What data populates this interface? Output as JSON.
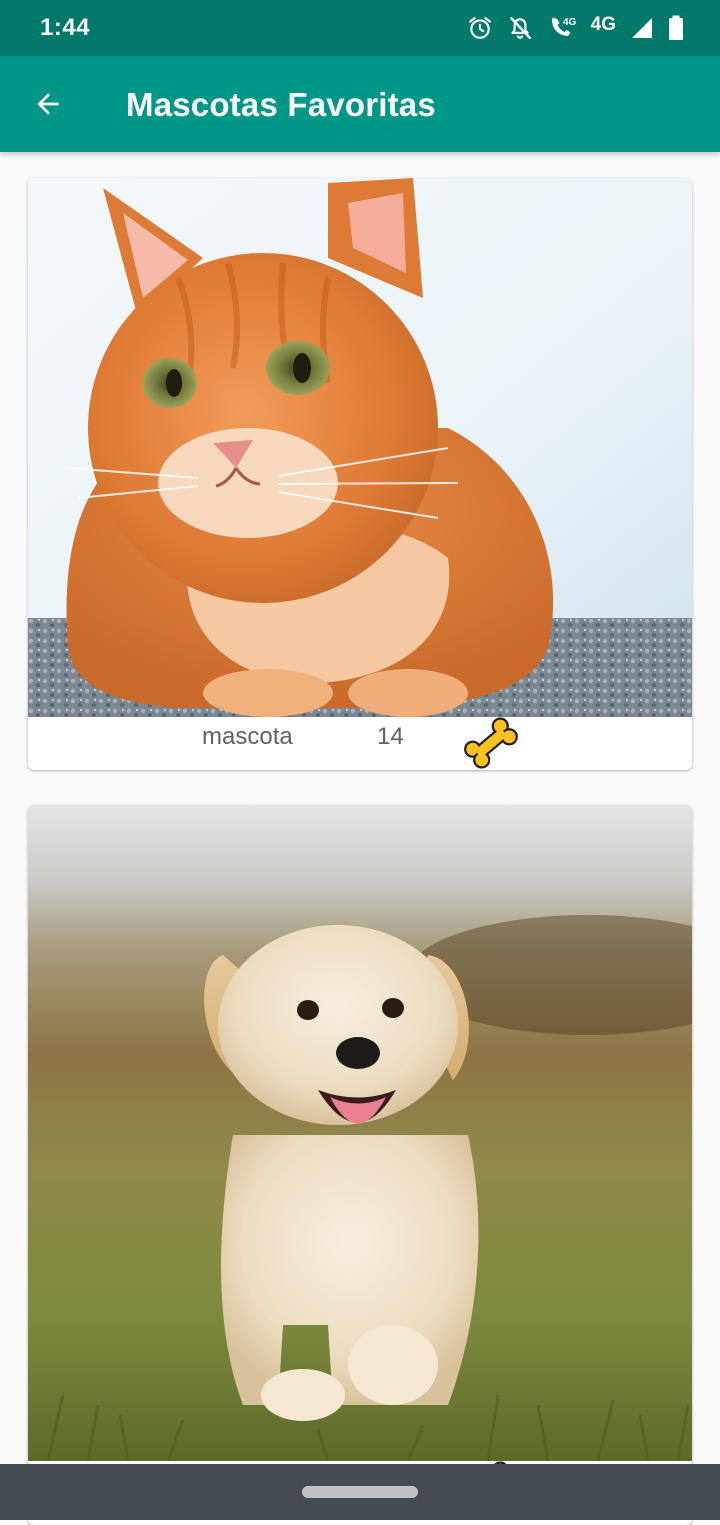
{
  "status_bar": {
    "time": "1:44",
    "network_type": "4G",
    "icons": [
      "alarm-icon",
      "notifications-off-icon",
      "volte-call-icon",
      "signal-icon",
      "battery-icon"
    ]
  },
  "app_bar": {
    "title": "Mascotas Favoritas",
    "back_icon": "arrow-back-icon",
    "color": "#009688",
    "status_color": "#00796b"
  },
  "pets": [
    {
      "name": "mascota",
      "rating": "14",
      "photo": "orange-cat-photo",
      "like_icon": "bone-icon"
    },
    {
      "name": "",
      "rating": "",
      "photo": "golden-puppy-photo",
      "like_icon": "bone-icon"
    }
  ],
  "nav_bar": {
    "home_handle": "home-gesture-pill"
  },
  "colors": {
    "accent": "#009688",
    "bone": "#f9c21d",
    "text_secondary": "#616161"
  }
}
